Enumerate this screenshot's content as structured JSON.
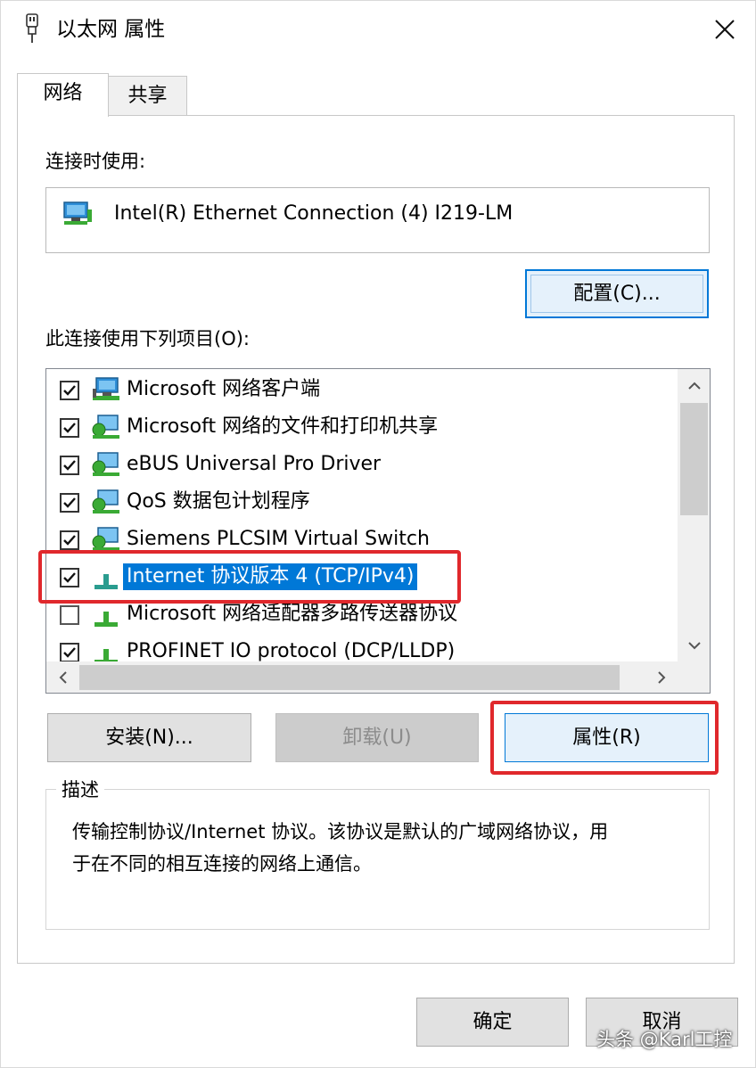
{
  "window": {
    "title": "以太网 属性",
    "close_glyph": "✕"
  },
  "tabs": [
    {
      "label": "网络",
      "active": true
    },
    {
      "label": "共享",
      "active": false
    }
  ],
  "connect_using": {
    "label": "连接时使用:",
    "adapter_name": "Intel(R) Ethernet Connection (4) I219-LM",
    "configure_label": "配置(C)..."
  },
  "items_section": {
    "label": "此连接使用下列项目(O):",
    "items": [
      {
        "label": "Microsoft 网络客户端",
        "checked": true,
        "icon": "network-client-icon",
        "selected": false
      },
      {
        "label": "Microsoft 网络的文件和打印机共享",
        "checked": true,
        "icon": "network-service-icon",
        "selected": false
      },
      {
        "label": "eBUS Universal Pro Driver",
        "checked": true,
        "icon": "network-service-icon",
        "selected": false
      },
      {
        "label": "QoS 数据包计划程序",
        "checked": true,
        "icon": "network-service-icon",
        "selected": false
      },
      {
        "label": "Siemens PLCSIM Virtual Switch",
        "checked": true,
        "icon": "network-service-icon",
        "selected": false
      },
      {
        "label": "Internet 协议版本 4 (TCP/IPv4)",
        "checked": true,
        "icon": "protocol-icon",
        "selected": true
      },
      {
        "label": "Microsoft 网络适配器多路传送器协议",
        "checked": false,
        "icon": "protocol-icon",
        "selected": false
      },
      {
        "label": "PROFINET IO protocol (DCP/LLDP)",
        "checked": true,
        "icon": "protocol-icon",
        "selected": false
      }
    ]
  },
  "actions": {
    "install_label": "安装(N)...",
    "uninstall_label": "卸载(U)",
    "properties_label": "属性(R)"
  },
  "description": {
    "legend": "描述",
    "text_line1": "传输控制协议/Internet 协议。该协议是默认的广域网络协议，用",
    "text_line2": "于在不同的相互连接的网络上通信。"
  },
  "footer": {
    "ok_label": "确定",
    "cancel_label": "取消"
  },
  "watermark": "头条 @Karl工控",
  "colors": {
    "accent": "#0078d7",
    "highlight_red": "#e0282c",
    "button_face": "#e1e1e1"
  }
}
